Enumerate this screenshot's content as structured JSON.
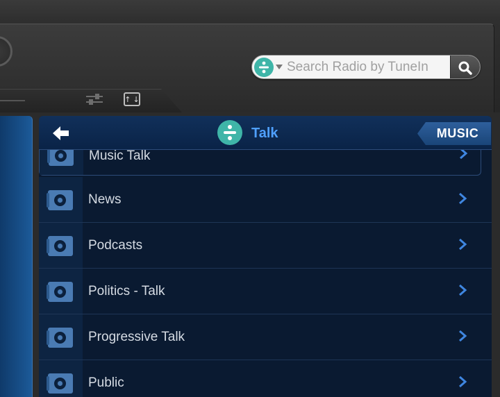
{
  "toolbar": {
    "search": {
      "placeholder": "Search Radio by TuneIn"
    }
  },
  "header": {
    "title": "Talk",
    "music_label": "MUSIC"
  },
  "list": {
    "items": [
      {
        "label": "Music Talk"
      },
      {
        "label": "News"
      },
      {
        "label": "Podcasts"
      },
      {
        "label": "Politics - Talk"
      },
      {
        "label": "Progressive Talk"
      },
      {
        "label": "Public"
      }
    ]
  },
  "colors": {
    "accent": "#4fa0ff",
    "tunein_logo": "#3fb5a8",
    "panel_bg": "#0a1a31",
    "icon_blue": "#4a7bb3"
  },
  "icons": [
    "tunein-logo-icon",
    "chevron-down-icon",
    "search-icon",
    "equalizer-icon",
    "mixer-icon",
    "back-arrow-icon",
    "radio-icon",
    "chevron-right-icon"
  ]
}
